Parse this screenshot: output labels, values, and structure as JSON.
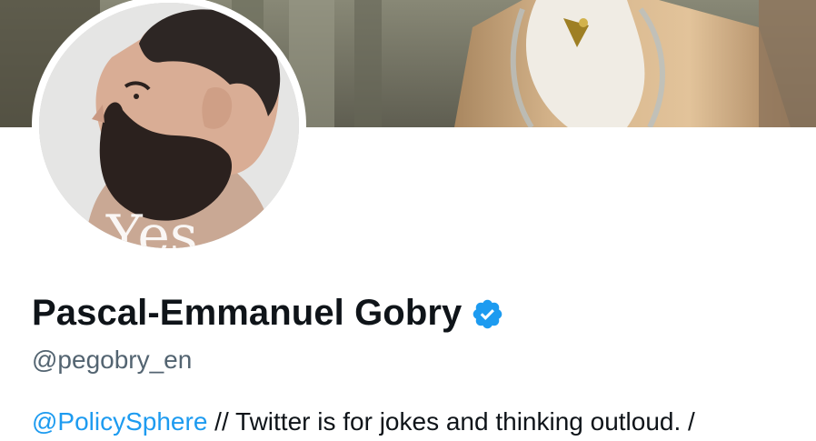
{
  "profile": {
    "display_name": "Pascal-Emmanuel Gobry",
    "handle": "@pegobry_en",
    "verified": true,
    "bio": {
      "mention": "@PolicySphere",
      "text": " // Twitter is for jokes and thinking outloud. /"
    },
    "avatar_overlay_text": "Yes"
  },
  "icons": {
    "verified": "verified-badge-icon"
  },
  "colors": {
    "name": "#0f1419",
    "handle": "#536471",
    "link": "#1d9bf0",
    "badge": "#1d9bf0",
    "background": "#ffffff"
  }
}
